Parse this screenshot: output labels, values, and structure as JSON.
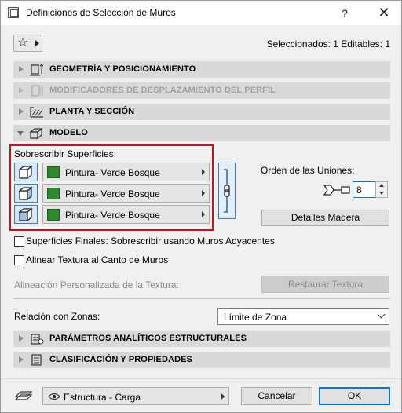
{
  "window": {
    "title": "Definiciones de Selección de Muros",
    "help_label": "?",
    "close_label": "✕"
  },
  "toolbar": {
    "favorites_icon": "star-icon",
    "selected_info": "Seleccionados: 1 Editables: 1"
  },
  "panels": [
    {
      "label": "GEOMETRÍA Y POSICIONAMIENTO",
      "icon": "geometry-icon",
      "state": "collapsed"
    },
    {
      "label": "MODIFICADORES DE DESPLAZAMIENTO DEL PERFIL",
      "icon": "profile-modifier-icon",
      "state": "disabled"
    },
    {
      "label": "PLANTA Y SECCIÓN",
      "icon": "floor-plan-icon",
      "state": "collapsed"
    },
    {
      "label": "MODELO",
      "icon": "model-icon",
      "state": "expanded"
    }
  ],
  "model": {
    "override_label": "Sobrescribir Superficies:",
    "surfaces": [
      {
        "icon": "outside-face-icon",
        "material": "Pintura- Verde Bosque",
        "color": "#2f8a2f"
      },
      {
        "icon": "edge-face-icon",
        "material": "Pintura- Verde Bosque",
        "color": "#2f8a2f"
      },
      {
        "icon": "inside-face-icon",
        "material": "Pintura- Verde Bosque",
        "color": "#2f8a2f"
      }
    ],
    "chain_icon": "link-chain-icon",
    "joins_order_label": "Orden de las Uniones:",
    "joins_order_value": "8",
    "timber_details_label": "Detalles Madera",
    "end_surfaces_label": "Superficies Finales: Sobrescribir usando Muros Adyacentes",
    "align_texture_label": "Alinear Textura al Canto de Muros",
    "custom_alignment_label": "Alineación Personalizada de la Textura:",
    "restore_texture_label": "Restaurar Textura",
    "zone_relation_label": "Relación con Zonas:",
    "zone_relation_value": "Límite de Zona"
  },
  "lower_panels": [
    {
      "label": "PARÁMETROS ANALÍTICOS ESTRUCTURALES",
      "icon": "structural-analysis-icon",
      "state": "collapsed"
    },
    {
      "label": "CLASIFICACIÓN Y PROPIEDADES",
      "icon": "classification-icon",
      "state": "collapsed"
    }
  ],
  "footer": {
    "layer_icon": "layer-icon",
    "layer_value": "Estructura - Carga",
    "cancel_label": "Cancelar",
    "ok_label": "OK"
  },
  "colors": {
    "highlight_frame": "#c0161e",
    "accent": "#0078d7",
    "panel_header": "#d9d9d9"
  }
}
